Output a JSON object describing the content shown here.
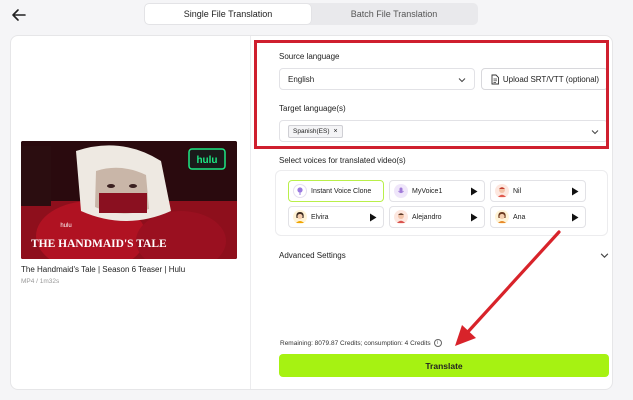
{
  "tabs": [
    {
      "label": "Single File Translation",
      "active": true
    },
    {
      "label": "Batch File Translation",
      "active": false
    }
  ],
  "video": {
    "title": "The Handmaid's Tale | Season 6 Teaser | Hulu",
    "meta": "MP4 / 1m32s",
    "thumbnail_text": {
      "brand": "hulu",
      "small_brand": "hulu",
      "show_title": "THE HANDMAID'S TALE"
    }
  },
  "source": {
    "label": "Source language",
    "value": "English",
    "upload_label": "Upload SRT/VTT (optional)"
  },
  "target": {
    "label": "Target language(s)",
    "chip": "Spanish(ES)",
    "chip_remove": "×"
  },
  "voices": {
    "label": "Select voices for translated video(s)",
    "items": [
      {
        "name": "Instant Voice Clone",
        "selected": true,
        "avatar": "clone-icon"
      },
      {
        "name": "MyVoice1",
        "selected": false,
        "avatar": "mic-avatar"
      },
      {
        "name": "Nil",
        "selected": false,
        "avatar": "man-avatar"
      },
      {
        "name": "Elvira",
        "selected": false,
        "avatar": "woman-avatar"
      },
      {
        "name": "Alejandro",
        "selected": false,
        "avatar": "man-avatar"
      },
      {
        "name": "Ana",
        "selected": false,
        "avatar": "woman-avatar"
      }
    ]
  },
  "advanced": {
    "label": "Advanced Settings"
  },
  "credits": {
    "text": "Remaining: 8079.87 Credits; consumption: 4 Credits",
    "info": "i"
  },
  "translate": {
    "label": "Translate"
  },
  "colors": {
    "accent": "#a6f212",
    "highlight": "#cf1f2e",
    "selected_voice_border": "#b9ef4a"
  }
}
